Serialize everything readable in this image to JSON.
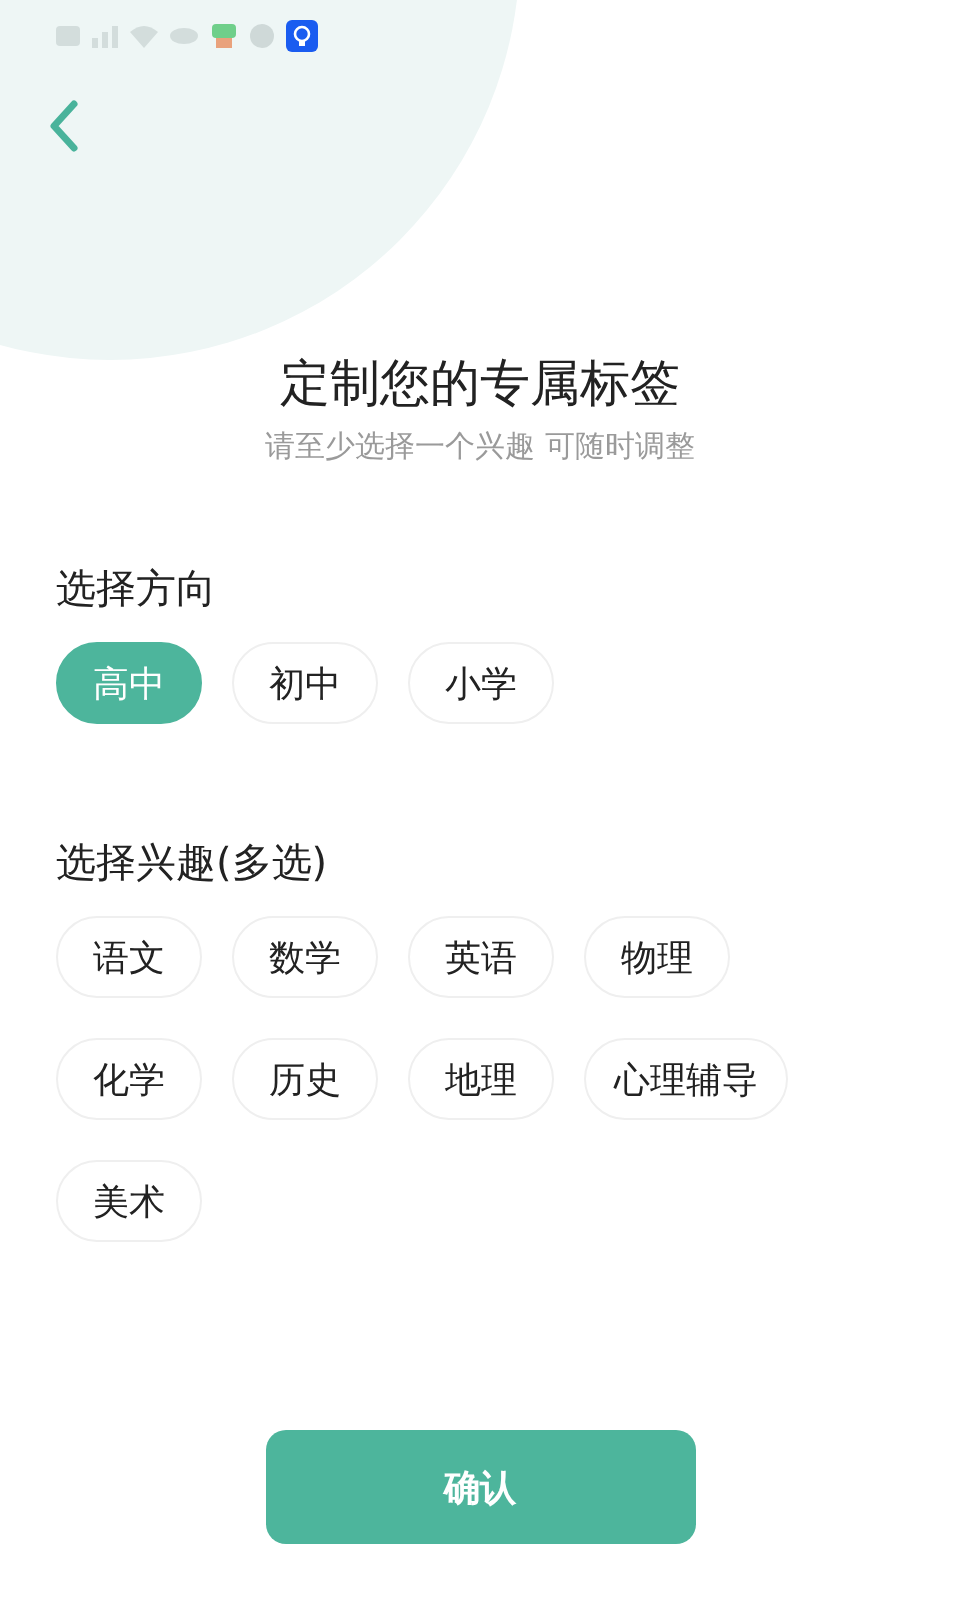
{
  "header": {
    "title": "定制您的专属标签",
    "subtitle": "请至少选择一个兴趣 可随时调整"
  },
  "direction": {
    "heading": "选择方向",
    "options": [
      {
        "label": "高中",
        "selected": true
      },
      {
        "label": "初中",
        "selected": false
      },
      {
        "label": "小学",
        "selected": false
      }
    ]
  },
  "interests": {
    "heading": "选择兴趣(多选)",
    "options": [
      {
        "label": "语文",
        "selected": false
      },
      {
        "label": "数学",
        "selected": false
      },
      {
        "label": "英语",
        "selected": false
      },
      {
        "label": "物理",
        "selected": false
      },
      {
        "label": "化学",
        "selected": false
      },
      {
        "label": "历史",
        "selected": false
      },
      {
        "label": "地理",
        "selected": false
      },
      {
        "label": "心理辅导",
        "selected": false
      },
      {
        "label": "美术",
        "selected": false
      }
    ]
  },
  "confirm_button": "确认"
}
